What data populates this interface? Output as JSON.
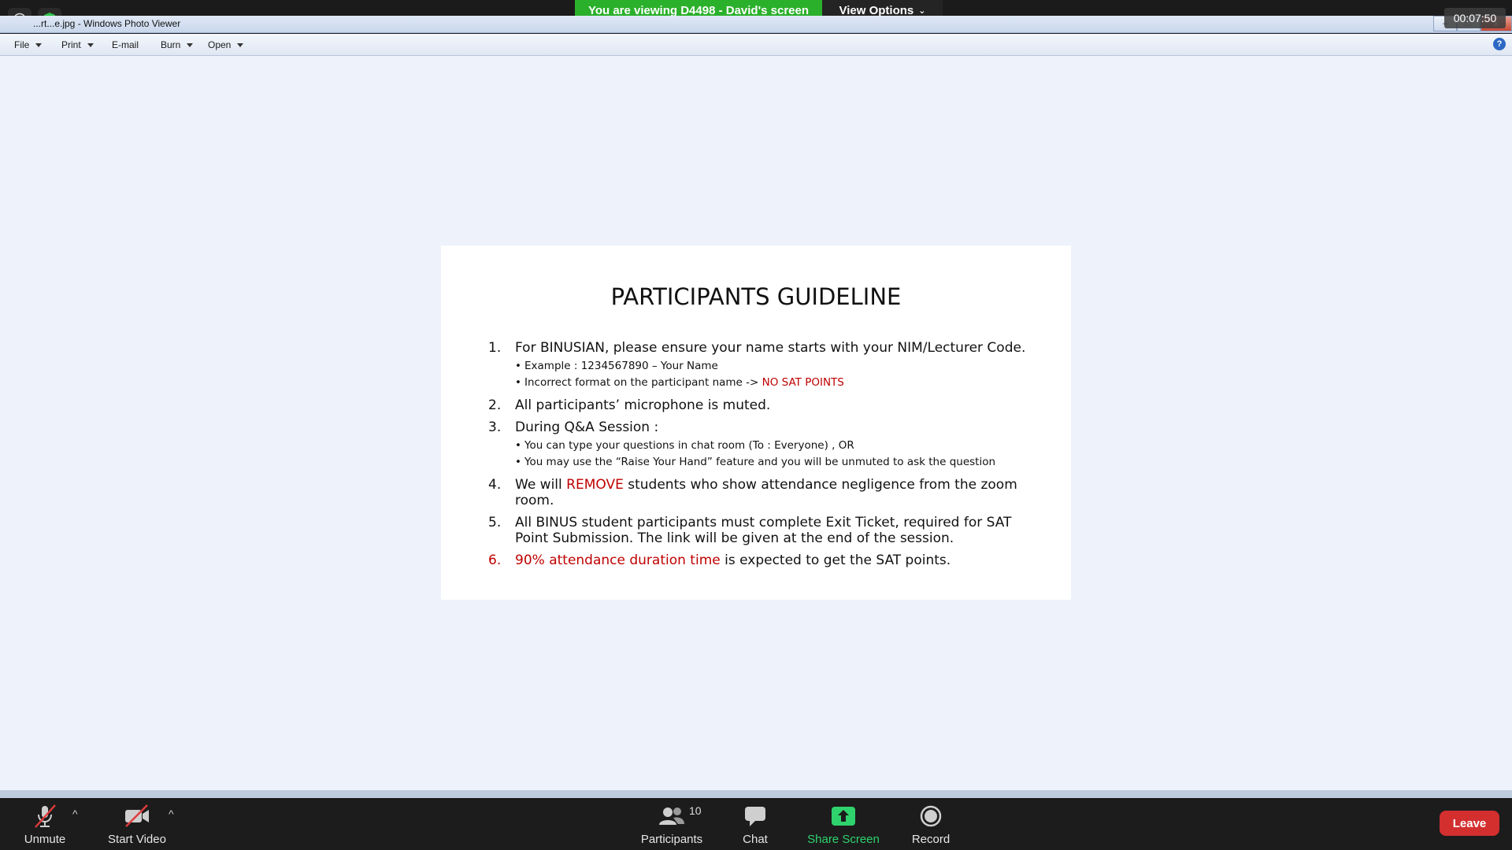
{
  "zoom": {
    "share_banner": "You are viewing D4498 - David's screen",
    "view_options_label": "View Options",
    "timer": "00:07:50"
  },
  "window": {
    "title": "...rt...e.jpg - Windows Photo Viewer",
    "menu": {
      "file": "File",
      "print": "Print",
      "email": "E-mail",
      "burn": "Burn",
      "open": "Open"
    }
  },
  "slide": {
    "title": "PARTICIPANTS GUIDELINE",
    "items": [
      {
        "num": "1.",
        "text": "For BINUSIAN, please ensure your name starts with your NIM/Lecturer Code.",
        "sub": [
          {
            "text": "Example : 1234567890 – Your Name"
          },
          {
            "text": "Incorrect format on the participant name -> ",
            "red": "NO SAT POINTS"
          }
        ]
      },
      {
        "num": "2.",
        "text": "All participants’ microphone is muted."
      },
      {
        "num": "3.",
        "text": "During Q&A Session :",
        "sub": [
          {
            "text": "You can type your questions in chat room (To : Everyone) , OR"
          },
          {
            "text": "You may use the “Raise Your Hand” feature and you will be unmuted to ask the question"
          }
        ]
      },
      {
        "num": "4.",
        "pre": "We will ",
        "red": "REMOVE",
        "post": " students who show attendance negligence from the zoom room."
      },
      {
        "num": "5.",
        "text": "All BINUS student participants must complete Exit Ticket, required for SAT Point Submission. The link will be given at the end of the session."
      },
      {
        "num": "6.",
        "red": "90% attendance duration time",
        "post": " is expected to get the SAT points."
      }
    ]
  },
  "toolbar": {
    "unmute": "Unmute",
    "start_video": "Start Video",
    "participants": "Participants",
    "participants_count": "10",
    "chat": "Chat",
    "share_screen": "Share Screen",
    "record": "Record",
    "leave": "Leave"
  },
  "colors": {
    "share_green": "#2bb02b",
    "leave_red": "#d32f2f",
    "accent_red": "#c00000"
  }
}
